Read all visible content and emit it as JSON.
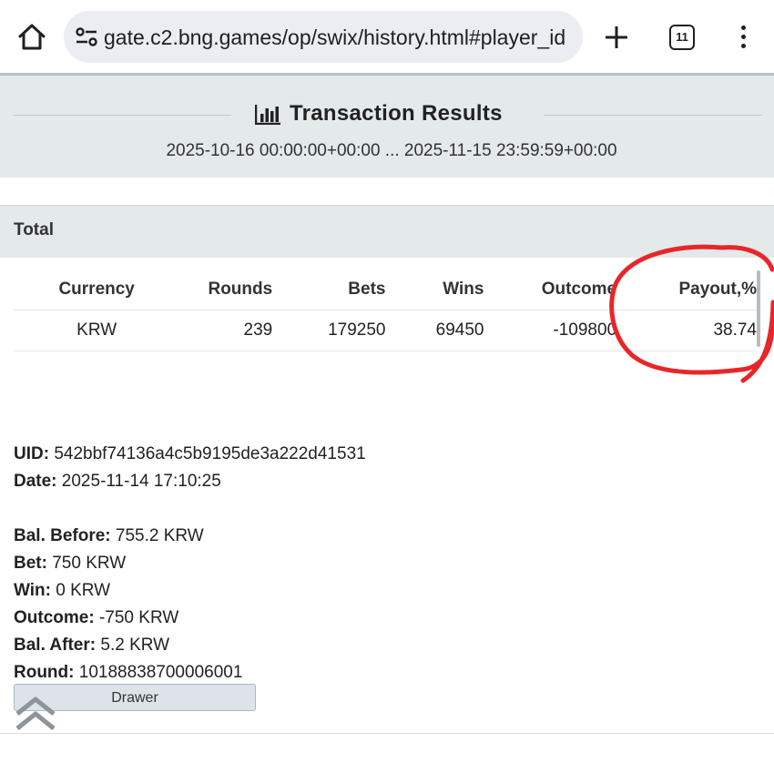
{
  "browser": {
    "url": "gate.c2.bng.games/op/swix/history.html#player_id",
    "tab_count": "11"
  },
  "header": {
    "title": "Transaction Results",
    "date_range": "2025-10-16 00:00:00+00:00 ... 2025-11-15 23:59:59+00:00"
  },
  "total": {
    "section_label": "Total",
    "columns": [
      "Currency",
      "Rounds",
      "Bets",
      "Wins",
      "Outcome",
      "Payout,%"
    ],
    "rows": [
      [
        "KRW",
        "239",
        "179250",
        "69450",
        "-109800",
        "38.74"
      ]
    ]
  },
  "details": {
    "uid_label": "UID:",
    "uid": "542bbf74136a4c5b9195de3a222d41531",
    "date_label": "Date:",
    "date": "2025-11-14 17:10:25",
    "bal_before_label": "Bal. Before:",
    "bal_before": "755.2 KRW",
    "bet_label": "Bet:",
    "bet": "750 KRW",
    "win_label": "Win:",
    "win": "0 KRW",
    "outcome_label": "Outcome:",
    "outcome": "-750 KRW",
    "bal_after_label": "Bal. After:",
    "bal_after": "5.2 KRW",
    "round_label": "Round:",
    "round": "10188838700006001"
  },
  "drawer_label": "Drawer",
  "colors": {
    "header_bg": "#e4e9ea",
    "annotation": "#e8262a",
    "drawer_bg": "#dde3e9"
  },
  "icons": [
    "home-icon",
    "site-settings-icon",
    "plus-icon",
    "tab-switcher-icon",
    "more-vert-icon",
    "bar-chart-icon",
    "scroll-top-icon"
  ]
}
